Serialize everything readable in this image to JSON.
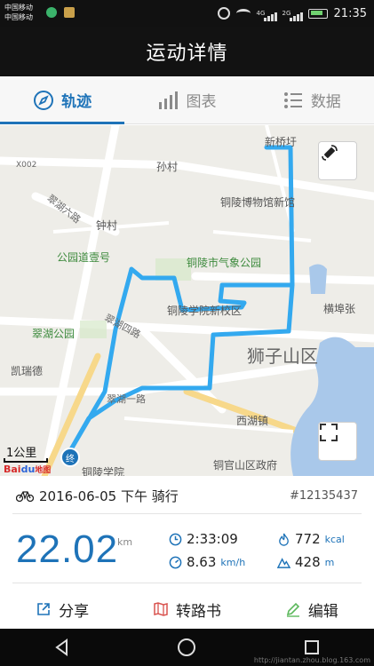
{
  "status_bar": {
    "carrier1": "中国移动",
    "carrier2": "中国移动",
    "net1": "4G",
    "net2": "2G",
    "time": "21:35"
  },
  "header": {
    "title": "运动详情"
  },
  "tabs": [
    {
      "label": "轨迹",
      "icon": "compass-icon",
      "active": true
    },
    {
      "label": "图表",
      "icon": "bar-chart-icon",
      "active": false
    },
    {
      "label": "数据",
      "icon": "list-icon",
      "active": false
    }
  ],
  "map": {
    "labels": {
      "xinqiao": "新桥圩",
      "x002": "X002",
      "suncun": "孙村",
      "museum": "铜陵博物馆新馆",
      "cuihu_road": "翠湖六路",
      "zhongcun": "钟村",
      "gongyuan": "公园道壹号",
      "weather_park": "铜陵市气象公园",
      "hengbuzhang": "横埠张",
      "college": "铜陵学院新校区",
      "cuihu_si": "翠湖四路",
      "cuihu_park": "翠湖公园",
      "district": "狮子山区",
      "kairuide": "凯瑞德",
      "cuihu_yi": "翠湖一路",
      "xihu": "西湖镇",
      "tongling_xueyuan": "铜陵学院",
      "gov": "铜官山区政府"
    },
    "scale": "1公里",
    "end_marker": "终",
    "baidu": {
      "bai": "Bai",
      "du": "du",
      "map": "地图"
    }
  },
  "ride": {
    "date": "2016-06-05 下午 骑行",
    "id": "#12135437",
    "distance": "22.02",
    "distance_unit": "km",
    "duration": "2:33:09",
    "speed": "8.63",
    "speed_unit": "km/h",
    "calories": "772",
    "calories_unit": "kcal",
    "elevation": "428",
    "elevation_unit": "m"
  },
  "actions": [
    {
      "label": "分享",
      "icon": "share-icon"
    },
    {
      "label": "转路书",
      "icon": "roadbook-icon"
    },
    {
      "label": "编辑",
      "icon": "edit-icon"
    }
  ],
  "watermark": "http://jiantan.zhou.blog.163.com",
  "colors": {
    "accent": "#1e73b8",
    "route": "#33a9ef",
    "header": "#121212"
  }
}
